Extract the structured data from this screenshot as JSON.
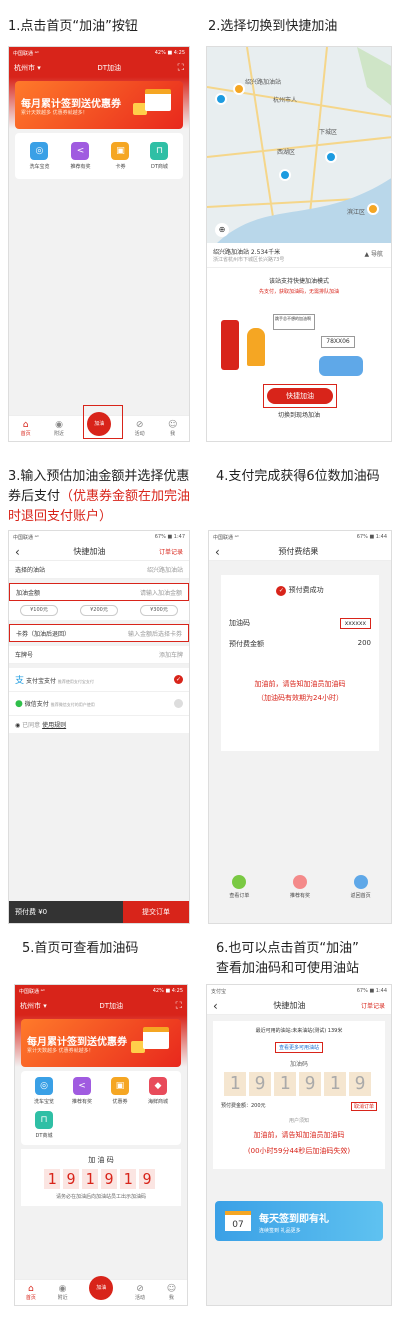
{
  "captions": {
    "s1": "1.点击首页“加油”按钮",
    "s2": "2.选择切换到快捷加油",
    "s3_a": "3.输入预估加油金额并选择优惠",
    "s3_b": "券后支付",
    "s3_c": "（优惠券金额在加完油",
    "s3_d": "时退回支付账户）",
    "s4": "4.支付完成获得6位数加油码",
    "s5": "5.首页可查看加油码",
    "s6_a": "6.也可以点击首页“加油”",
    "s6_b": "查看加油码和可使用油站"
  },
  "status": {
    "carrier": "中国联通 ᵃᵈ",
    "battery": "42% ■ 4:25",
    "battery2": "67% ■ 1:47",
    "battery3": "67% ■ 1:44",
    "carrier2": "中国联通 ᵃᵈ",
    "carrier3": "支付宝"
  },
  "home": {
    "city": "杭州市 ▾",
    "title": "DT加油",
    "banner_title": "每月累计签到送优惠券",
    "banner_sub": "累计天数越多 优惠券就越多！",
    "icons": [
      {
        "label": "洗车宝览",
        "color": "#3aa0e6",
        "glyph": "◎"
      },
      {
        "label": "推荐有奖",
        "color": "#a05be0",
        "glyph": "<"
      },
      {
        "label": "卡券",
        "color": "#f5a623",
        "glyph": "▣"
      },
      {
        "label": "DT商城",
        "color": "#2fbfa5",
        "glyph": "⊓"
      }
    ],
    "icons5": [
      {
        "label": "洗车宝览",
        "color": "#3aa0e6",
        "glyph": "◎"
      },
      {
        "label": "推荐有奖",
        "color": "#a05be0",
        "glyph": "<"
      },
      {
        "label": "优惠券",
        "color": "#f5a623",
        "glyph": "▣"
      },
      {
        "label": "海鲜商城",
        "color": "#e84b5b",
        "glyph": "◆"
      },
      {
        "label": "DT商城",
        "color": "#2fbfa5",
        "glyph": "⊓"
      }
    ],
    "tabs": [
      "首页",
      "附近",
      "加油",
      "活动",
      "我"
    ],
    "code_title": "加 油 码",
    "code_digits": [
      "1",
      "9",
      "1",
      "9",
      "1",
      "9"
    ],
    "code_note": "请务必在加油后向加油站员工出示加油码"
  },
  "map": {
    "labels": [
      "振华站",
      "绍兴路加油站",
      "杭州市人",
      "下城区",
      "北山路",
      "翠苑",
      "西湖区",
      "下沙",
      "之江",
      "滨江区"
    ],
    "station_name": "绍兴路加油站 2.534千米",
    "station_addr": "浙江省杭州市下城区长兴路73号",
    "nav": "导航",
    "promo_title": "该站支持快捷加油模式",
    "promo_sub": "先支付，获取加油码，无需排队加油",
    "bubble": "跳手总不想的加油啊",
    "plate": "78XX06",
    "button": "快捷加油",
    "switch": "切换到现场加油"
  },
  "order": {
    "back": "‹",
    "title": "快捷加油",
    "records": "订单记录",
    "station_label": "选择的油站",
    "station_value": "绍兴路加油站",
    "amount_label": "加油金额",
    "amount_placeholder": "请输入加油金额",
    "amounts": [
      "¥100元",
      "¥200元",
      "¥300元"
    ],
    "coupon_label": "卡券（加油后退回）",
    "coupon_value": "输入金额后选择卡券",
    "plate_label": "车牌号",
    "plate_value": "添加车牌",
    "pay1": "支付宝支付",
    "pay1_sub": "推荐使用支付宝支付",
    "pay2": "微信支付",
    "pay2_sub": "推荐微信支付的用户使用",
    "agree": "已同意",
    "rules": "使用规则",
    "prepay": "预付费 ¥0",
    "submit": "提交订单"
  },
  "result": {
    "title": "预付费结果",
    "success": "预付费成功",
    "code_label": "加油码",
    "code_value": "xxxxxx",
    "amount_label": "预付费金额",
    "amount_value": "200",
    "note1": "加油前，请告知加油员加油码",
    "note2": "（加油码有效期为24小时）",
    "actions": [
      "查看订单",
      "推荐有奖",
      "返回首页"
    ]
  },
  "quick": {
    "title": "快捷加油",
    "records": "订单记录",
    "nearest": "最近可用的油站:未来油站(测试) 139米",
    "view_link": "查看更多可用油站",
    "code_title": "加油码",
    "digits": [
      "1",
      "9",
      "1",
      "9",
      "1",
      "9"
    ],
    "prepaid": "预付费金额：200元",
    "cancel": "取消订单",
    "notice_title": "用户须知",
    "notice1": "加油前，请告知加油员加油码",
    "notice2": "(00小时59分44秒后加油码失效)",
    "banner_title": "每天签到即有礼",
    "banner_sub": "连续签到 礼品更多",
    "banner_num": "07"
  },
  "colors": {
    "brand": "#d8241a"
  }
}
